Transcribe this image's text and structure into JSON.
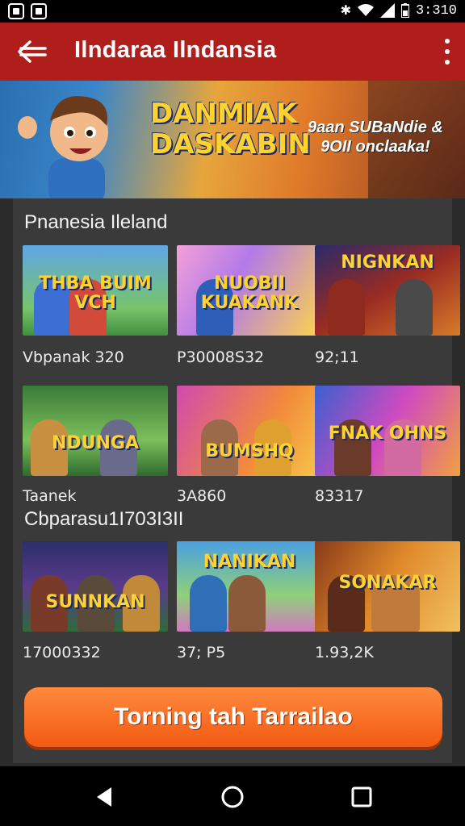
{
  "status_bar": {
    "time": "3:310",
    "icons": [
      "notification-icon",
      "android-icon",
      "bluetooth-icon",
      "wifi-icon",
      "signal-icon",
      "battery-icon"
    ]
  },
  "app_bar": {
    "title": "Ilndaraa Ilndansia",
    "back_icon": "back-arrow-icon",
    "more_icon": "more-vertical-icon"
  },
  "banner": {
    "title": "DANMIAK DASKABIN",
    "tagline": "9aan SUBaNdie & 9OII onclaaka!"
  },
  "section1": {
    "title": "Pnanesia Ileland"
  },
  "section2": {
    "title": "Cbparasu1I703I3II"
  },
  "rows": [
    [
      {
        "label": "THBA BUIM VCH",
        "count": "Vbpanak 320"
      },
      {
        "label": "NUOBII KUAKANK",
        "count": "P30008S32"
      },
      {
        "label": "NIGNKAN",
        "count": "92;11"
      }
    ],
    [
      {
        "label": "NDUNGA",
        "count": "Taanek"
      },
      {
        "label": "BUMSHQ",
        "count": "3A860"
      },
      {
        "label": "FNAK OHNS",
        "count": "83317"
      }
    ],
    [
      {
        "label": "SUNNKAN",
        "count": "17000332"
      },
      {
        "label": "NANIKAN",
        "count": "37; P5"
      },
      {
        "label": "SONAKAR",
        "count": "1.93,2K"
      }
    ]
  ],
  "cta": {
    "label": "Torning tah Tarrailao"
  },
  "nav": {
    "icons": [
      "back-triangle-icon",
      "home-circle-icon",
      "recents-square-icon"
    ]
  },
  "colors": {
    "app_bar": "#b01e1c",
    "cta_top": "#ff8a3d",
    "cta_bottom": "#f25a12",
    "panel": "#3a3a3a"
  }
}
